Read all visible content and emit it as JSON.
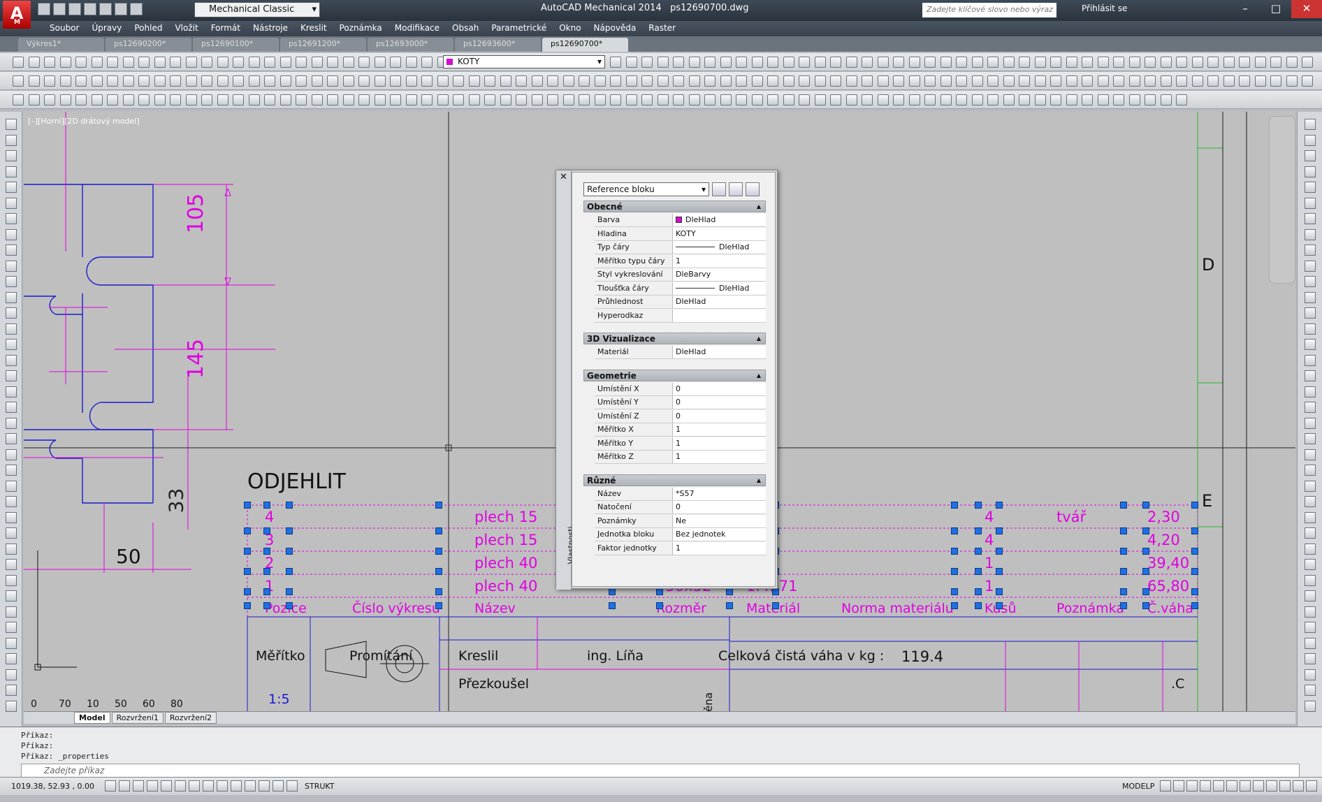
{
  "window": {
    "title": "AutoCAD Mechanical 2014",
    "filename": "ps12690700.dwg",
    "workspace": "Mechanical Classic",
    "search_placeholder": "Zadejte klíčové slovo nebo výraz",
    "login": "Přihlásit se"
  },
  "menu": [
    "Soubor",
    "Úpravy",
    "Pohled",
    "Vložit",
    "Formát",
    "Nástroje",
    "Kreslit",
    "Poznámka",
    "Modifikace",
    "Obsah",
    "Parametrické",
    "Okno",
    "Nápověda",
    "Raster"
  ],
  "doc_tabs": [
    "Výkres1*",
    "ps12690200*",
    "ps12690100*",
    "ps12691200*",
    "ps12693000*",
    "ps12693600*",
    "ps12690700*"
  ],
  "active_tab": "ps12690700*",
  "layer": "KOTY",
  "viewport_label": "[–][Horní][2D drátový model]",
  "drawing": {
    "dims": [
      "105",
      "145",
      "33",
      "50"
    ],
    "note": "ODJEHLIT",
    "zone_letters": [
      "D",
      "E"
    ],
    "bom_rows": [
      [
        "4",
        "",
        "plech 15",
        "",
        "",
        "",
        "4",
        "tvář",
        "2,30"
      ],
      [
        "3",
        "",
        "plech 15",
        "",
        "",
        "",
        "4",
        "",
        "4,20"
      ],
      [
        "2",
        "",
        "plech 40",
        "",
        "",
        "",
        "1",
        "",
        "39,40"
      ],
      [
        "1",
        "",
        "plech 40",
        "750x32",
        "1.4571",
        "",
        "1",
        "",
        "65,80"
      ]
    ],
    "bom_header": [
      "Pozice",
      "Číslo výkresu",
      "Název",
      "Rozměr",
      "Materiál",
      "Norma materiálu",
      "Kusů",
      "Poznámka",
      "Č.váha"
    ],
    "title_block": {
      "meritko": "Měřítko",
      "promitani": "Promítání",
      "kreslil": "Kreslil",
      "kreslil_name": "ing. Líňa",
      "celkova": "Celková čistá váha v kg :",
      "weight": "119.4",
      "prezkousel": "Přezkoušel",
      "scale": "1:5",
      "sheet_code": ".C",
      "ena": "ěna"
    },
    "ruler": [
      "0",
      "70",
      "10",
      "50",
      "60",
      "80"
    ]
  },
  "properties": {
    "selector": "Reference bloku",
    "palette_title": "Vlastnosti",
    "sections": [
      {
        "name": "Obecné",
        "rows": [
          [
            "Barva",
            "DleHlad"
          ],
          [
            "Hladina",
            "KOTY"
          ],
          [
            "Typ čáry",
            "DleHlad"
          ],
          [
            "Měřítko typu čáry",
            "1"
          ],
          [
            "Styl vykreslování",
            "DleBarvy"
          ],
          [
            "Tloušťka čáry",
            "DleHlad"
          ],
          [
            "Průhlednost",
            "DleHlad"
          ],
          [
            "Hyperodkaz",
            ""
          ]
        ]
      },
      {
        "name": "3D Vizualizace",
        "rows": [
          [
            "Materiál",
            "DleHlad"
          ]
        ]
      },
      {
        "name": "Geometrie",
        "rows": [
          [
            "Umístění X",
            "0"
          ],
          [
            "Umístění Y",
            "0"
          ],
          [
            "Umístění Z",
            "0"
          ],
          [
            "Měřítko X",
            "1"
          ],
          [
            "Měřítko Y",
            "1"
          ],
          [
            "Měřítko Z",
            "1"
          ]
        ]
      },
      {
        "name": "Různé",
        "rows": [
          [
            "Název",
            "*S57"
          ],
          [
            "Natočení",
            "0"
          ],
          [
            "Poznámky",
            "Ne"
          ],
          [
            "Jednotka bloku",
            "Bez jednotek"
          ],
          [
            "Faktor jednotky",
            "1"
          ]
        ]
      }
    ]
  },
  "layout_tabs": [
    "Model",
    "Rozvržení1",
    "Rozvržení2"
  ],
  "command": {
    "history": [
      "Příkaz:",
      "Příkaz:",
      "Příkaz: _properties"
    ],
    "placeholder": "Zadejte příkaz"
  },
  "status": {
    "coords": "1019.38, 52.93 , 0.00",
    "strukt": "STRUKT",
    "modelp": "MODELP"
  },
  "colors": {
    "dim": "#e000e0",
    "geometry": "#1a1acc",
    "grip": "#1f6fe0"
  }
}
